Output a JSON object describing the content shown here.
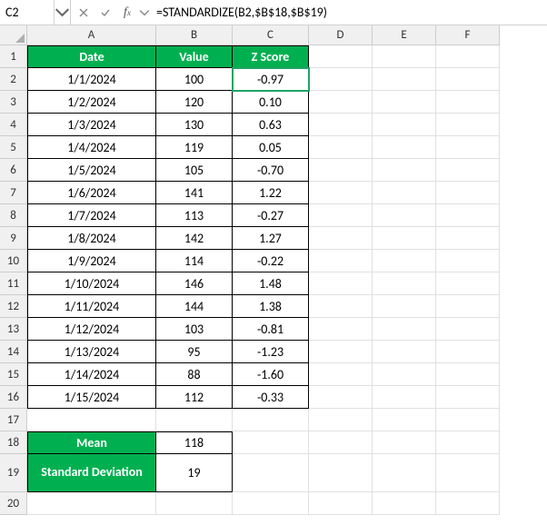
{
  "namebox": "C2",
  "formula": "=STANDARDIZE(B2,$B$18,$B$19)",
  "columns": [
    "A",
    "B",
    "C",
    "D",
    "E",
    "F"
  ],
  "rows": [
    "1",
    "2",
    "3",
    "4",
    "5",
    "6",
    "7",
    "8",
    "9",
    "10",
    "11",
    "12",
    "13",
    "14",
    "15",
    "16",
    "17",
    "18",
    "19",
    "20"
  ],
  "headers": {
    "A": "Date",
    "B": "Value",
    "C": "Z Score"
  },
  "dataRows": [
    {
      "date": "1/1/2024",
      "value": "100",
      "z": "-0.97"
    },
    {
      "date": "1/2/2024",
      "value": "120",
      "z": "0.10"
    },
    {
      "date": "1/3/2024",
      "value": "130",
      "z": "0.63"
    },
    {
      "date": "1/4/2024",
      "value": "119",
      "z": "0.05"
    },
    {
      "date": "1/5/2024",
      "value": "105",
      "z": "-0.70"
    },
    {
      "date": "1/6/2024",
      "value": "141",
      "z": "1.22"
    },
    {
      "date": "1/7/2024",
      "value": "113",
      "z": "-0.27"
    },
    {
      "date": "1/8/2024",
      "value": "142",
      "z": "1.27"
    },
    {
      "date": "1/9/2024",
      "value": "114",
      "z": "-0.22"
    },
    {
      "date": "1/10/2024",
      "value": "146",
      "z": "1.48"
    },
    {
      "date": "1/11/2024",
      "value": "144",
      "z": "1.38"
    },
    {
      "date": "1/12/2024",
      "value": "103",
      "z": "-0.81"
    },
    {
      "date": "1/13/2024",
      "value": "95",
      "z": "-1.23"
    },
    {
      "date": "1/14/2024",
      "value": "88",
      "z": "-1.60"
    },
    {
      "date": "1/15/2024",
      "value": "112",
      "z": "-0.33"
    }
  ],
  "stats": {
    "meanLabel": "Mean",
    "meanValue": "118",
    "sdLabel": "Standard Deviation",
    "sdValue": "19"
  },
  "chart_data": {
    "type": "table",
    "title": "Z Score computation",
    "columns": [
      "Date",
      "Value",
      "Z Score"
    ],
    "rows": [
      [
        "1/1/2024",
        100,
        -0.97
      ],
      [
        "1/2/2024",
        120,
        0.1
      ],
      [
        "1/3/2024",
        130,
        0.63
      ],
      [
        "1/4/2024",
        119,
        0.05
      ],
      [
        "1/5/2024",
        105,
        -0.7
      ],
      [
        "1/6/2024",
        141,
        1.22
      ],
      [
        "1/7/2024",
        113,
        -0.27
      ],
      [
        "1/8/2024",
        142,
        1.27
      ],
      [
        "1/9/2024",
        114,
        -0.22
      ],
      [
        "1/10/2024",
        146,
        1.48
      ],
      [
        "1/11/2024",
        144,
        1.38
      ],
      [
        "1/12/2024",
        103,
        -0.81
      ],
      [
        "1/13/2024",
        95,
        -1.23
      ],
      [
        "1/14/2024",
        88,
        -1.6
      ],
      [
        "1/15/2024",
        112,
        -0.33
      ]
    ],
    "mean": 118,
    "std_dev": 19
  }
}
